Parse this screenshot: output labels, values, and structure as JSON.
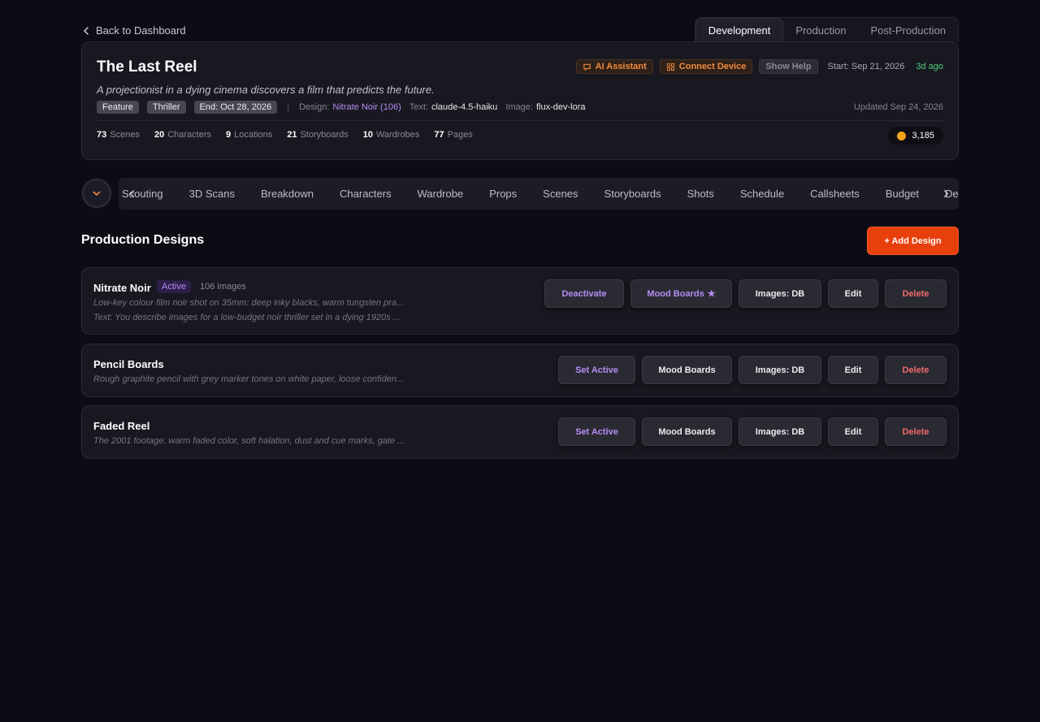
{
  "nav": {
    "back_label": "Back to Dashboard"
  },
  "phase_tabs": [
    {
      "label": "Development",
      "active": true
    },
    {
      "label": "Production",
      "active": false
    },
    {
      "label": "Post-Production",
      "active": false
    }
  ],
  "project": {
    "title": "The Last Reel",
    "tagline": "A projectionist in a dying cinema discovers a film that predicts the future.",
    "actions": {
      "ai_assistant": "AI Assistant",
      "connect_device": "Connect Device",
      "show_help": "Show Help"
    },
    "start": "Start: Sep 21, 2026",
    "ago": "3d ago",
    "tags": [
      "Feature",
      "Thriller",
      "End: Oct 28, 2026"
    ],
    "meta": {
      "design_label": "Design:",
      "design_value": "Nitrate Noir (106)",
      "text_label": "Text:",
      "text_value": "claude-4.5-haiku",
      "image_label": "Image:",
      "image_value": "flux-dev-lora"
    },
    "updated": "Updated Sep 24, 2026",
    "stats": [
      {
        "num": "73",
        "label": "Scenes"
      },
      {
        "num": "20",
        "label": "Characters"
      },
      {
        "num": "9",
        "label": "Locations"
      },
      {
        "num": "21",
        "label": "Storyboards"
      },
      {
        "num": "10",
        "label": "Wardrobes"
      },
      {
        "num": "77",
        "label": "Pages"
      }
    ],
    "credits": "3,185"
  },
  "modules": [
    "Scouting",
    "3D Scans",
    "Breakdown",
    "Characters",
    "Wardrobe",
    "Props",
    "Scenes",
    "Storyboards",
    "Shots",
    "Schedule",
    "Callsheets",
    "Budget",
    "Deals"
  ],
  "section": {
    "title": "Production Designs",
    "add_label": "+ Add Design"
  },
  "designs": [
    {
      "name": "Nitrate Noir",
      "badge": "Active",
      "count": "106 images",
      "desc1": "Low-key colour film noir shot on 35mm: deep inky blacks, warm tungsten pra...",
      "desc2": "Text: You describe images for a low-budget noir thriller set in a dying 1920s ...",
      "primary_action": "Deactivate",
      "mood_label": "Mood Boards",
      "mood_starred": true,
      "images_label": "Images: DB",
      "edit_label": "Edit",
      "delete_label": "Delete"
    },
    {
      "name": "Pencil Boards",
      "desc1": "Rough graphite pencil with grey marker tones on white paper, loose confiden...",
      "primary_action": "Set Active",
      "mood_label": "Mood Boards",
      "images_label": "Images: DB",
      "edit_label": "Edit",
      "delete_label": "Delete"
    },
    {
      "name": "Faded Reel",
      "desc1": "The 2001 footage: warm faded color, soft halation, dust and cue marks, gate ...",
      "primary_action": "Set Active",
      "mood_label": "Mood Boards",
      "images_label": "Images: DB",
      "edit_label": "Edit",
      "delete_label": "Delete"
    }
  ],
  "colors": {
    "accent": "#e8400d",
    "purple": "#b58cf2",
    "orange": "#f28a3c",
    "green": "#4fce7a",
    "danger": "#ee6a6a"
  }
}
